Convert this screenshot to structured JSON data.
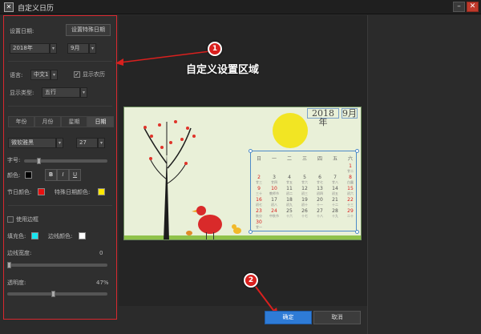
{
  "window": {
    "title": "自定义日历",
    "min_icon": "minimize-icon",
    "close_icon": "close-icon"
  },
  "settings": {
    "set_date_label": "设置日期:",
    "special_date_button": "设置特殊日期",
    "year_value": "2018年",
    "month_value": "9月",
    "language_label": "语言:",
    "language_value": "中文1",
    "lunar_checkbox_label": "显示农历",
    "display_type_label": "显示类型:",
    "display_type_value": "五行",
    "tabs": [
      "年份",
      "月份",
      "星期",
      "日期"
    ],
    "font_value": "微软雅黑",
    "font_size_value": "27",
    "size_label": "字号:",
    "color_label": "颜色:",
    "style_buttons": [
      "B",
      "I",
      "U"
    ],
    "holiday_color_label": "节日颜色:",
    "special_color_label": "特殊日期颜色:",
    "use_border_label": "使用边框",
    "fill_color_label": "填充色:",
    "border_color_label": "边线颜色:",
    "border_width_label": "边线宽度:",
    "border_width_value": "0",
    "opacity_label": "透明度:",
    "opacity_value": "47%",
    "colors": {
      "text": "#000000",
      "holiday": "#e81010",
      "special": "#ffe800",
      "fill": "#18e6f0",
      "border": "#ffffff"
    }
  },
  "annotations": {
    "marker1": "1",
    "marker2": "2",
    "callout1": "自定义设置区域"
  },
  "preview": {
    "year": "2018年",
    "month": "9月",
    "weekdays": [
      "日",
      "一",
      "二",
      "三",
      "四",
      "五",
      "六"
    ],
    "weeks": [
      [
        {
          "d": "",
          "l": ""
        },
        {
          "d": "",
          "l": ""
        },
        {
          "d": "",
          "l": ""
        },
        {
          "d": "",
          "l": ""
        },
        {
          "d": "",
          "l": ""
        },
        {
          "d": "",
          "l": ""
        },
        {
          "d": "1",
          "l": "廿二",
          "r": true
        }
      ],
      [
        {
          "d": "2",
          "l": "廿三",
          "r": true
        },
        {
          "d": "3",
          "l": "廿四"
        },
        {
          "d": "4",
          "l": "廿五"
        },
        {
          "d": "5",
          "l": "廿六"
        },
        {
          "d": "6",
          "l": "廿七"
        },
        {
          "d": "7",
          "l": "廿八"
        },
        {
          "d": "8",
          "l": "白露",
          "r": true
        }
      ],
      [
        {
          "d": "9",
          "l": "三十",
          "r": true
        },
        {
          "d": "10",
          "l": "教师节",
          "r": true
        },
        {
          "d": "11",
          "l": "初二"
        },
        {
          "d": "12",
          "l": "初三"
        },
        {
          "d": "13",
          "l": "初四"
        },
        {
          "d": "14",
          "l": "初五"
        },
        {
          "d": "15",
          "l": "初六",
          "r": true
        }
      ],
      [
        {
          "d": "16",
          "l": "初七",
          "r": true
        },
        {
          "d": "17",
          "l": "初八"
        },
        {
          "d": "18",
          "l": "初九"
        },
        {
          "d": "19",
          "l": "初十"
        },
        {
          "d": "20",
          "l": "十一"
        },
        {
          "d": "21",
          "l": "十二"
        },
        {
          "d": "22",
          "l": "十三",
          "r": true
        }
      ],
      [
        {
          "d": "23",
          "l": "秋分",
          "r": true
        },
        {
          "d": "24",
          "l": "中秋节",
          "r": true
        },
        {
          "d": "25",
          "l": "十六"
        },
        {
          "d": "26",
          "l": "十七"
        },
        {
          "d": "27",
          "l": "十八"
        },
        {
          "d": "28",
          "l": "十九"
        },
        {
          "d": "29",
          "l": "二十",
          "r": true
        }
      ],
      [
        {
          "d": "30",
          "l": "廿一",
          "r": true
        },
        {
          "d": "",
          "l": ""
        },
        {
          "d": "",
          "l": ""
        },
        {
          "d": "",
          "l": ""
        },
        {
          "d": "",
          "l": ""
        },
        {
          "d": "",
          "l": ""
        },
        {
          "d": "",
          "l": ""
        }
      ]
    ]
  },
  "footer": {
    "ok_label": "确定",
    "cancel_label": "取消"
  }
}
